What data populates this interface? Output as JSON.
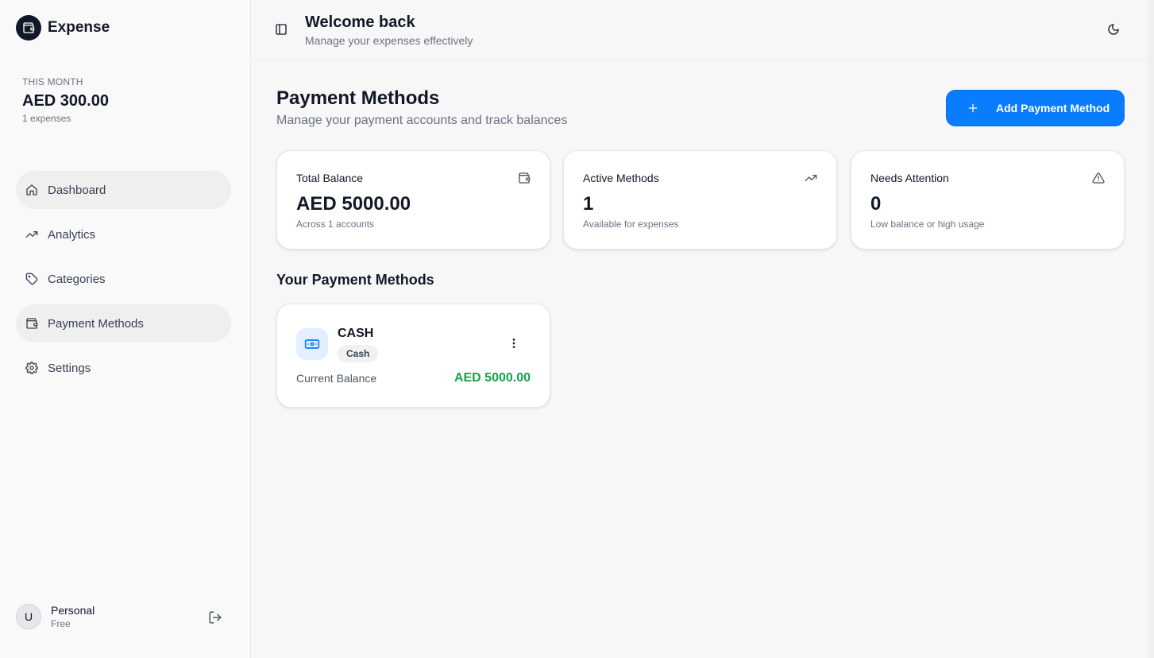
{
  "brand": {
    "name": "Expense",
    "icon": "wallet-icon"
  },
  "sidebar": {
    "month_label": "THIS MONTH",
    "month_amount": "AED 300.00",
    "month_count": "1 expenses",
    "items": [
      {
        "label": "Dashboard",
        "icon": "home-icon",
        "active": true
      },
      {
        "label": "Analytics",
        "icon": "trending-up-icon",
        "active": false
      },
      {
        "label": "Categories",
        "icon": "tag-icon",
        "active": false
      },
      {
        "label": "Payment Methods",
        "icon": "wallet-icon",
        "active": true
      },
      {
        "label": "Settings",
        "icon": "gear-icon",
        "active": false
      }
    ],
    "user": {
      "initial": "U",
      "name": "Personal",
      "plan": "Free"
    }
  },
  "header": {
    "title": "Welcome back",
    "subtitle": "Manage your expenses effectively"
  },
  "main": {
    "title": "Payment Methods",
    "subtitle": "Manage your payment accounts and track balances",
    "add_button": "Add Payment Method",
    "stats": [
      {
        "label": "Total Balance",
        "value": "AED 5000.00",
        "note": "Across 1 accounts",
        "icon": "wallet-icon"
      },
      {
        "label": "Active Methods",
        "value": "1",
        "note": "Available for expenses",
        "icon": "trending-up-icon"
      },
      {
        "label": "Needs Attention",
        "value": "0",
        "note": "Low balance or high usage",
        "icon": "alert-triangle-icon"
      }
    ],
    "section_title": "Your Payment Methods",
    "methods": [
      {
        "name": "CASH",
        "type": "Cash",
        "balance_label": "Current Balance",
        "balance": "AED 5000.00",
        "icon": "banknote-icon"
      }
    ]
  },
  "colors": {
    "accent": "#0a7cff",
    "balance_positive": "#16a34a",
    "active_nav": "#efefef"
  }
}
